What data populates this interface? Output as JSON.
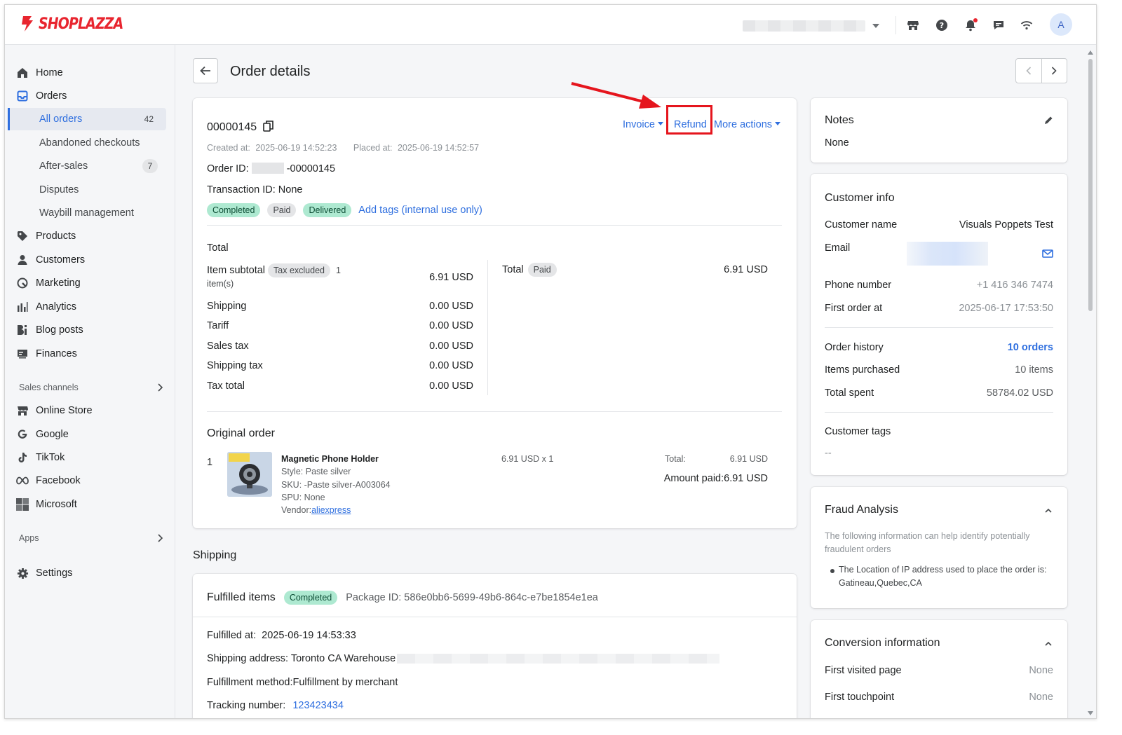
{
  "brand": {
    "name": "SHOPLAZZA",
    "color": "#e8252f",
    "accent": "#2f6fdf"
  },
  "topbar": {
    "avatar_letter": "A",
    "icons": [
      "store-icon",
      "help-icon",
      "bell-icon",
      "chat-icon",
      "wifi-icon"
    ]
  },
  "sidebar": {
    "items": [
      {
        "label": "Home",
        "icon": "home-icon"
      },
      {
        "label": "Orders",
        "icon": "orders-icon"
      },
      {
        "label": "Products",
        "icon": "tag-icon"
      },
      {
        "label": "Customers",
        "icon": "person-icon"
      },
      {
        "label": "Marketing",
        "icon": "marketing-icon"
      },
      {
        "label": "Analytics",
        "icon": "bar-chart-icon"
      },
      {
        "label": "Blog posts",
        "icon": "blog-icon"
      },
      {
        "label": "Finances",
        "icon": "finances-icon"
      }
    ],
    "order_sub": [
      {
        "label": "All orders",
        "count": "42"
      },
      {
        "label": "Abandoned checkouts"
      },
      {
        "label": "After-sales",
        "count": "7"
      },
      {
        "label": "Disputes"
      },
      {
        "label": "Waybill management"
      }
    ],
    "sales_channels_label": "Sales channels",
    "channels": [
      {
        "label": "Online Store",
        "icon": "store-icon"
      },
      {
        "label": "Google",
        "icon": "google-icon"
      },
      {
        "label": "TikTok",
        "icon": "tiktok-icon"
      },
      {
        "label": "Facebook",
        "icon": "meta-icon"
      },
      {
        "label": "Microsoft",
        "icon": "microsoft-icon"
      }
    ],
    "apps_label": "Apps",
    "settings_label": "Settings"
  },
  "page": {
    "title": "Order details"
  },
  "order": {
    "number": "00000145",
    "actions": {
      "invoice": "Invoice",
      "refund": "Refund",
      "more": "More actions"
    },
    "created_label": "Created at:",
    "created_at": "2025-06-19 14:52:23",
    "placed_label": "Placed at:",
    "placed_at": "2025-06-19 14:52:57",
    "order_id_label": "Order ID:",
    "order_id_suffix": "-00000145",
    "transaction_label": "Transaction ID: None",
    "tags": [
      "Completed",
      "Paid",
      "Delivered"
    ],
    "add_tags": "Add tags (internal use only)"
  },
  "totals": {
    "heading": "Total",
    "item_subtotal_label": "Item subtotal",
    "tax_excluded": "Tax excluded",
    "items_count_num": "1",
    "items_count_unit": "item(s)",
    "item_subtotal": "6.91 USD",
    "rows": [
      {
        "label": "Shipping",
        "value": "0.00 USD"
      },
      {
        "label": "Tariff",
        "value": "0.00 USD"
      },
      {
        "label": "Sales tax",
        "value": "0.00 USD"
      },
      {
        "label": "Shipping tax",
        "value": "0.00 USD"
      },
      {
        "label": "Tax total",
        "value": "0.00 USD"
      }
    ],
    "total_label": "Total",
    "total_status": "Paid",
    "total_value": "6.91 USD"
  },
  "original_order": {
    "heading": "Original order",
    "index": "1",
    "product_name": "Magnetic Phone Holder",
    "style": "Style: Paste silver",
    "sku": "SKU: -Paste silver-A003064",
    "spu": "SPU: None",
    "vendor_label": "Vendor:",
    "vendor": "aliexpress",
    "price_qty": "6.91 USD x 1",
    "total_label": "Total:",
    "total_value": "6.91 USD",
    "amount_paid": "Amount paid:6.91 USD"
  },
  "shipping": {
    "heading": "Shipping",
    "fulfilled_title": "Fulfilled items",
    "status": "Completed",
    "package_id": "Package ID: 586e0bb6-5699-49b6-864c-e7be1854e1ea",
    "fulfilled_at_label": "Fulfilled at:",
    "fulfilled_at": "2025-06-19 14:53:33",
    "address_label": "Shipping address: Toronto CA Warehouse",
    "method": "Fulfillment method:Fulfillment by merchant",
    "tracking_label": "Tracking number:",
    "tracking_number": "123423434"
  },
  "notes": {
    "title": "Notes",
    "value": "None"
  },
  "customer": {
    "title": "Customer info",
    "name_label": "Customer name",
    "name": "Visuals Poppets Test",
    "email_label": "Email",
    "phone_label": "Phone number",
    "phone": "+1 416 346 7474",
    "first_order_label": "First order at",
    "first_order": "2025-06-17 17:53:50",
    "history_label": "Order history",
    "history": "10 orders",
    "items_label": "Items purchased",
    "items": "10 items",
    "spent_label": "Total spent",
    "spent": "58784.02 USD",
    "tags_label": "Customer tags",
    "tags": "--"
  },
  "fraud": {
    "title": "Fraud Analysis",
    "description": "The following information can help identify potentially fraudulent orders",
    "bullet_line1": "The Location of IP address used to place the order is:",
    "bullet_line2": "Gatineau,Quebec,CA"
  },
  "conversion": {
    "title": "Conversion information",
    "first_page_label": "First visited page",
    "first_page": "None",
    "first_touch_label": "First touchpoint",
    "first_touch": "None"
  }
}
